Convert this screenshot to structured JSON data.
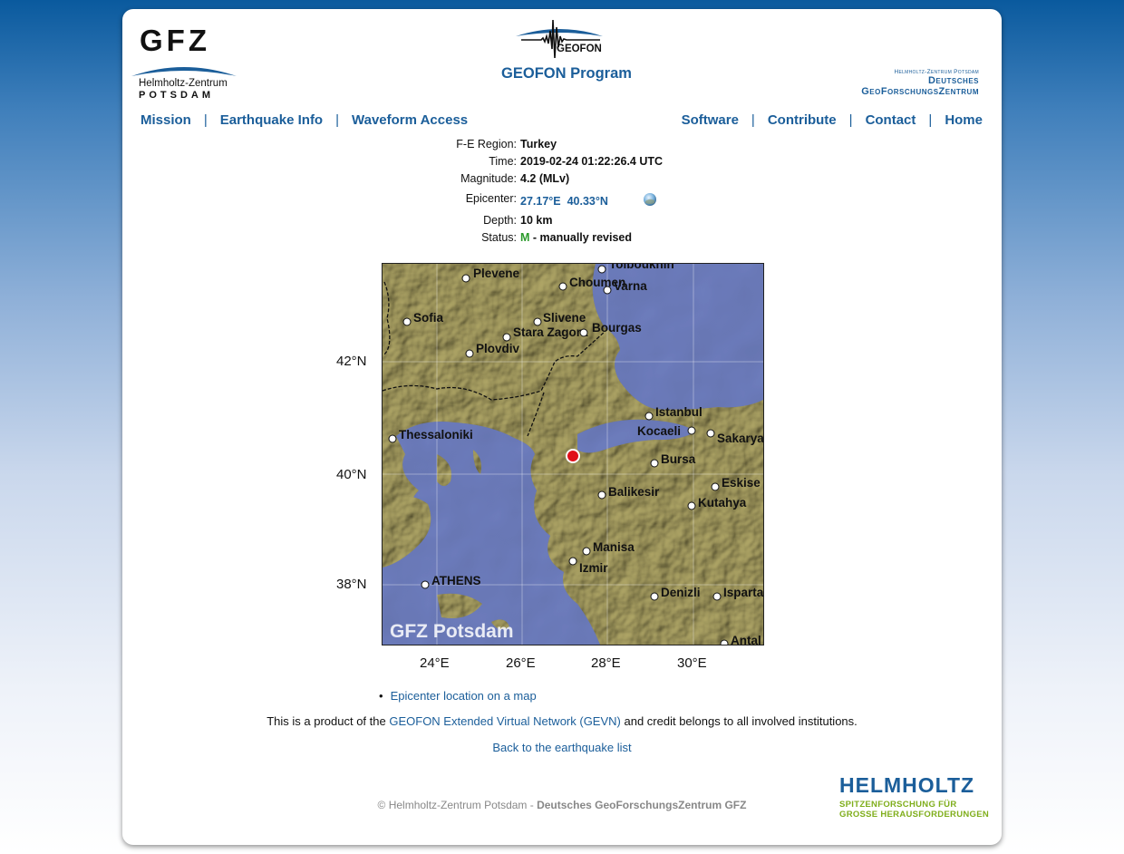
{
  "header": {
    "gfz_logo": "GFZ",
    "gfz_sub1": "Helmholtz-Zentrum",
    "gfz_sub2": "POTSDAM",
    "geofon_logo": "GEOFON",
    "program_title": "GEOFON Program",
    "dgfz_line1": "Helmholtz-Zentrum Potsdam",
    "dgfz_line2": "Deutsches",
    "dgfz_line3": "GeoForschungsZentrum"
  },
  "nav": {
    "left": [
      "Mission",
      "Earthquake Info",
      "Waveform Access"
    ],
    "right": [
      "Software",
      "Contribute",
      "Contact",
      "Home"
    ],
    "separator": "|"
  },
  "event": {
    "region_label": "F-E Region:",
    "region": "Turkey",
    "time_label": "Time:",
    "time": "2019-02-24 01:22:26.4 UTC",
    "magnitude_label": "Magnitude:",
    "magnitude": "4.2 (MLv)",
    "epicenter_label": "Epicenter:",
    "epicenter_lon": "27.17°E",
    "epicenter_lat": "40.33°N",
    "depth_label": "Depth:",
    "depth": "10 km",
    "status_label": "Status:",
    "status_code": "M",
    "status_text": "- manually revised"
  },
  "map": {
    "watermark": "GFZ Potsdam",
    "lat_ticks": [
      "42°N",
      "40°N",
      "38°N"
    ],
    "lon_ticks": [
      "24°E",
      "26°E",
      "28°E",
      "30°E"
    ],
    "cities": [
      "Tolboukhin",
      "Plevene",
      "Choumen",
      "Varna",
      "Sofia",
      "Slivene",
      "Stara Zagora",
      "Bourgas",
      "Plovdiv",
      "Istanbul",
      "Kocaeli",
      "Sakarya",
      "Thessaloniki",
      "Bursa",
      "Eskise",
      "Balikesir",
      "Kutahya",
      "Manisa",
      "Izmir",
      "ATHENS",
      "Denizli",
      "Isparta",
      "Antal"
    ],
    "colors": {
      "sea": "#6f7fc0",
      "land": "#a89f62",
      "epicenter": "#e0101a"
    }
  },
  "links": {
    "epicenter_map": "Epicenter location on a map",
    "credit_prefix": "This is a product of the",
    "credit_link": "GEOFON Extended Virtual Network (GEVN)",
    "credit_suffix": "and credit belongs to all involved institutions.",
    "back": "Back to the earthquake list"
  },
  "footer": {
    "copyright": "© Helmholtz-Zentrum Potsdam -",
    "copyright_bold": "Deutsches GeoForschungsZentrum GFZ",
    "helmholtz": "HELMHOLTZ",
    "helmholtz_sub1": "SPITZENFORSCHUNG FÜR",
    "helmholtz_sub2": "GROSSE HERAUSFORDERUNGEN"
  }
}
